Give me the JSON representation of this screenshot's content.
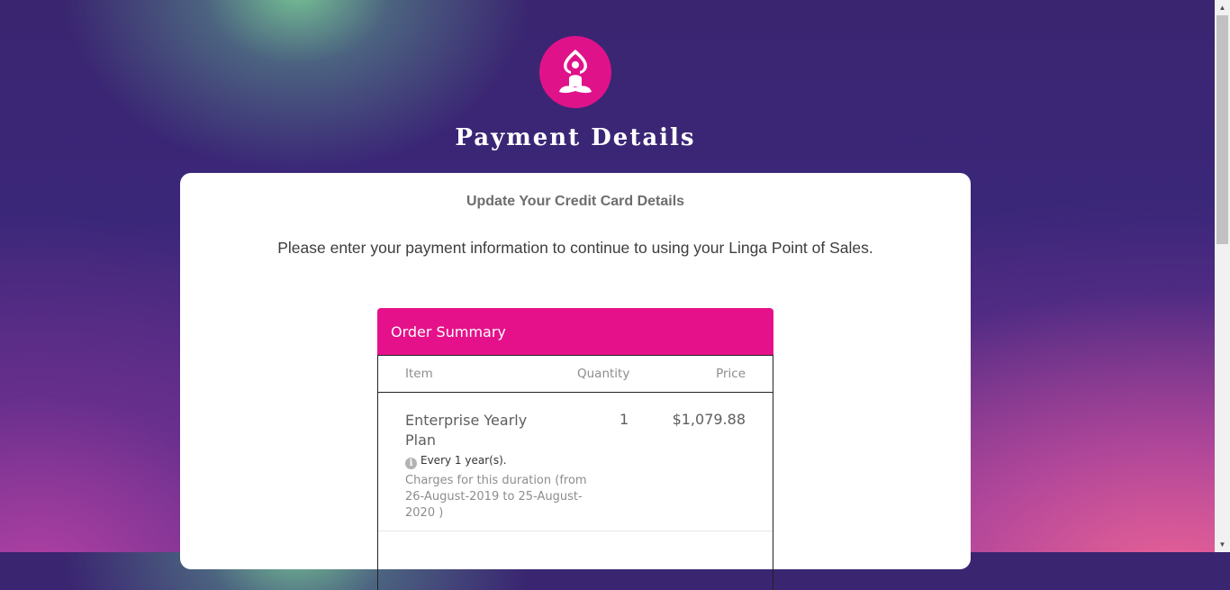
{
  "header": {
    "logo_icon": "meditation-icon",
    "title": "Payment Details"
  },
  "card": {
    "subtitle": "Update Your Credit Card Details",
    "description": "Please enter your payment information to continue to using your Linga Point of Sales."
  },
  "order_summary": {
    "title": "Order Summary",
    "columns": {
      "item": "Item",
      "quantity": "Quantity",
      "price": "Price"
    },
    "items": [
      {
        "name": "Enterprise Yearly Plan",
        "quantity": "1",
        "price": "$1,079.88",
        "frequency": "Every 1 year(s).",
        "charges": "Charges for this duration (from 26-August-2019 to 25-August-2020 )"
      }
    ]
  },
  "colors": {
    "accent": "#e5118a",
    "card_bg": "#ffffff"
  }
}
